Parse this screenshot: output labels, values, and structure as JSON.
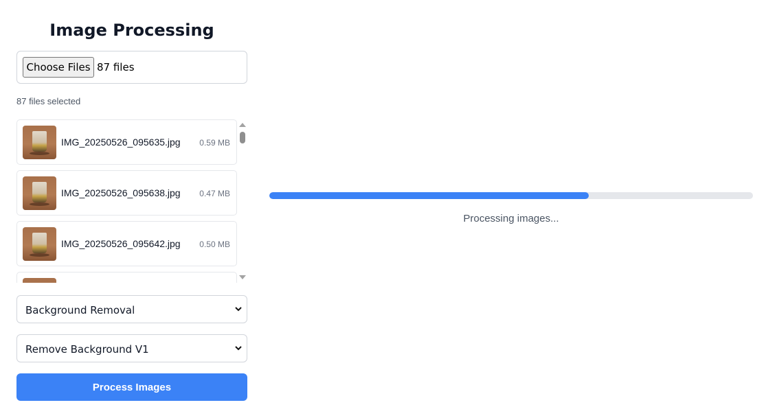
{
  "header": {
    "title": "Image Processing"
  },
  "file_input": {
    "button_label": "Choose Files",
    "count_text": "87 files"
  },
  "selected_text": "87 files selected",
  "files": [
    {
      "name": "IMG_20250526_095635.jpg",
      "size": "0.59 MB"
    },
    {
      "name": "IMG_20250526_095638.jpg",
      "size": "0.47 MB"
    },
    {
      "name": "IMG_20250526_095642.jpg",
      "size": "0.50 MB"
    }
  ],
  "selects": {
    "category": {
      "value": "Background Removal"
    },
    "model": {
      "value": "Remove Background V1"
    }
  },
  "process_button": {
    "label": "Process Images"
  },
  "progress": {
    "fraction": 0.66,
    "status": "Processing images..."
  },
  "colors": {
    "accent": "#3b82f6",
    "track": "#e5e7eb"
  }
}
